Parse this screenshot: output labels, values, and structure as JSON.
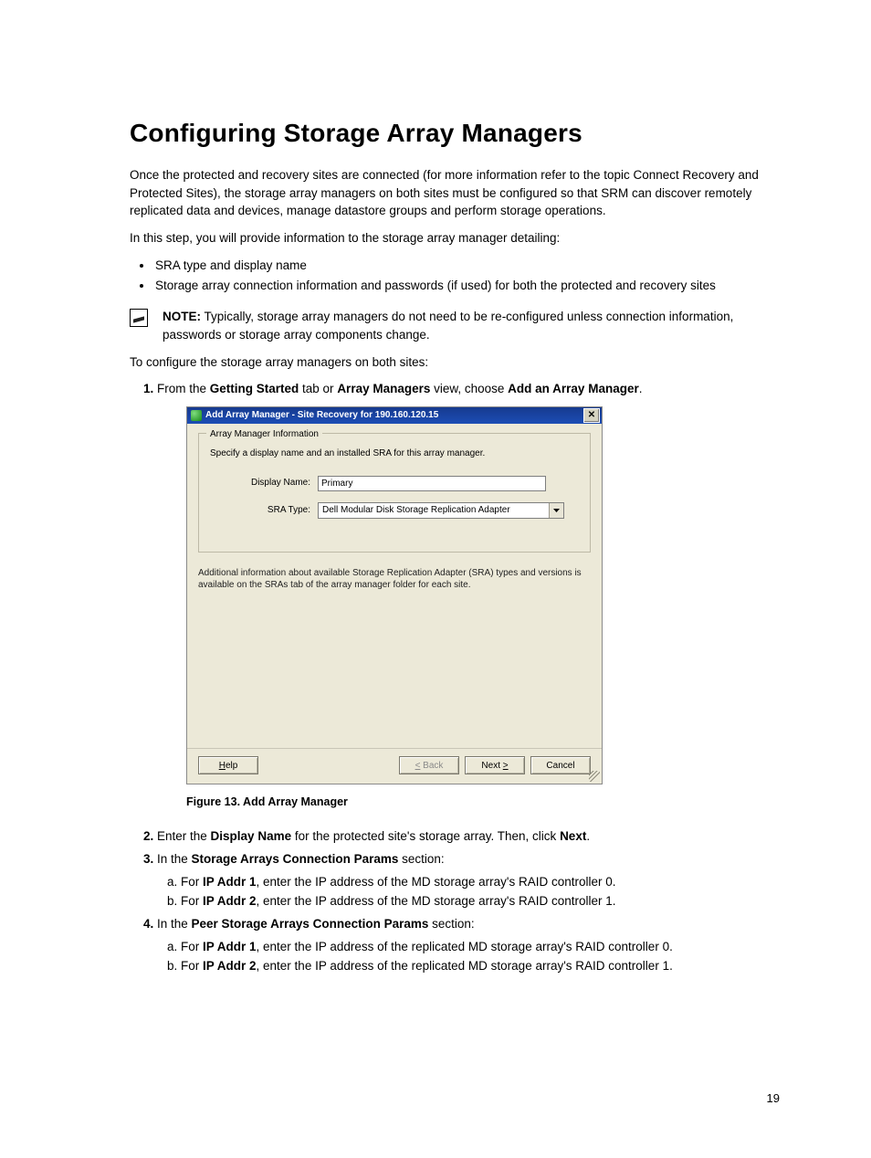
{
  "title": "Configuring Storage Array Managers",
  "intro1": "Once the protected and recovery sites are connected (for more information refer to the topic Connect Recovery and Protected Sites), the storage array managers on both sites must be configured so that SRM can discover remotely replicated data and devices, manage datastore groups and perform storage operations.",
  "intro2": "In this step, you will provide information to the storage array manager detailing:",
  "bullets": [
    "SRA type and display name",
    "Storage array connection information and passwords (if used) for both the protected and recovery sites"
  ],
  "note_label": "NOTE:",
  "note_text": " Typically, storage array managers do not need to be re-configured unless connection information, passwords or storage array components change.",
  "lead_in": "To configure the storage array managers on both sites:",
  "step1_a": "From the ",
  "step1_b": "Getting Started",
  "step1_c": " tab or ",
  "step1_d": "Array Managers",
  "step1_e": " view, choose ",
  "step1_f": "Add an Array Manager",
  "step1_g": ".",
  "dialog": {
    "title": "Add Array Manager - Site Recovery for 190.160.120.15",
    "legend": "Array Manager Information",
    "hint": "Specify a display name and an installed SRA for this array manager.",
    "display_name_label": "Display Name:",
    "display_name_value": "Primary",
    "sra_type_label": "SRA Type:",
    "sra_type_value": "Dell Modular Disk Storage Replication Adapter",
    "info_text": "Additional information about available Storage Replication Adapter (SRA) types and versions is available on the SRAs tab of the array manager folder for each site.",
    "help_btn_html": "<span class='u'>H</span>elp",
    "back_btn_html": "<span class='u'>&lt;</span> Back",
    "next_btn_html": "Next <span class='u'>&gt;</span>",
    "cancel_btn": "Cancel"
  },
  "figcap": "Figure 13. Add Array Manager",
  "step2_a": "Enter the ",
  "step2_b": "Display Name",
  "step2_c": " for the protected site's storage array. Then, click ",
  "step2_d": "Next",
  "step2_e": ".",
  "step3_a": "In the ",
  "step3_b": "Storage Arrays Connection Params",
  "step3_c": " section:",
  "step3a_a": "For ",
  "step3a_b": "IP Addr 1",
  "step3a_c": ", enter the IP address of the MD storage array's RAID controller 0.",
  "step3b_a": "For ",
  "step3b_b": "IP Addr 2",
  "step3b_c": ", enter the IP address of the MD storage array's RAID controller 1.",
  "step4_a": "In the ",
  "step4_b": "Peer Storage Arrays Connection Params",
  "step4_c": " section:",
  "step4a_a": "For ",
  "step4a_b": "IP Addr 1",
  "step4a_c": ", enter the IP address of the replicated MD storage array's RAID controller 0.",
  "step4b_a": "For ",
  "step4b_b": "IP Addr 2",
  "step4b_c": ", enter the IP address of the replicated MD storage array's RAID controller 1.",
  "page_num": "19"
}
